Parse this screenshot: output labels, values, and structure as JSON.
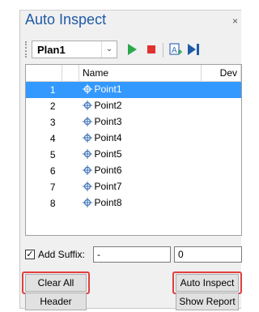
{
  "window": {
    "title": "Auto Inspect",
    "close_symbol": "×"
  },
  "toolbar": {
    "plan_value": "Plan1",
    "icons": [
      "play-icon",
      "stop-icon",
      "add-point-icon",
      "step-next-icon"
    ]
  },
  "grid": {
    "headers": [
      "",
      "",
      "Name",
      "Dev"
    ],
    "rows": [
      {
        "num": "1",
        "name": "Point1",
        "selected": true
      },
      {
        "num": "2",
        "name": "Point2"
      },
      {
        "num": "3",
        "name": "Point3"
      },
      {
        "num": "4",
        "name": "Point4"
      },
      {
        "num": "5",
        "name": "Point5"
      },
      {
        "num": "6",
        "name": "Point6"
      },
      {
        "num": "7",
        "name": "Point7"
      },
      {
        "num": "8",
        "name": "Point8"
      }
    ]
  },
  "suffix": {
    "label": "Add Suffix:",
    "checked": true,
    "text_value": "-",
    "number_value": "0"
  },
  "buttons": {
    "clear_all": "Clear All",
    "header": "Header",
    "auto_inspect": "Auto Inspect",
    "show_report": "Show Report"
  },
  "colors": {
    "title": "#1f5aa6",
    "selection": "#3399ff",
    "highlight": "#e04040",
    "play": "#2aa84a",
    "stop": "#e03030"
  }
}
